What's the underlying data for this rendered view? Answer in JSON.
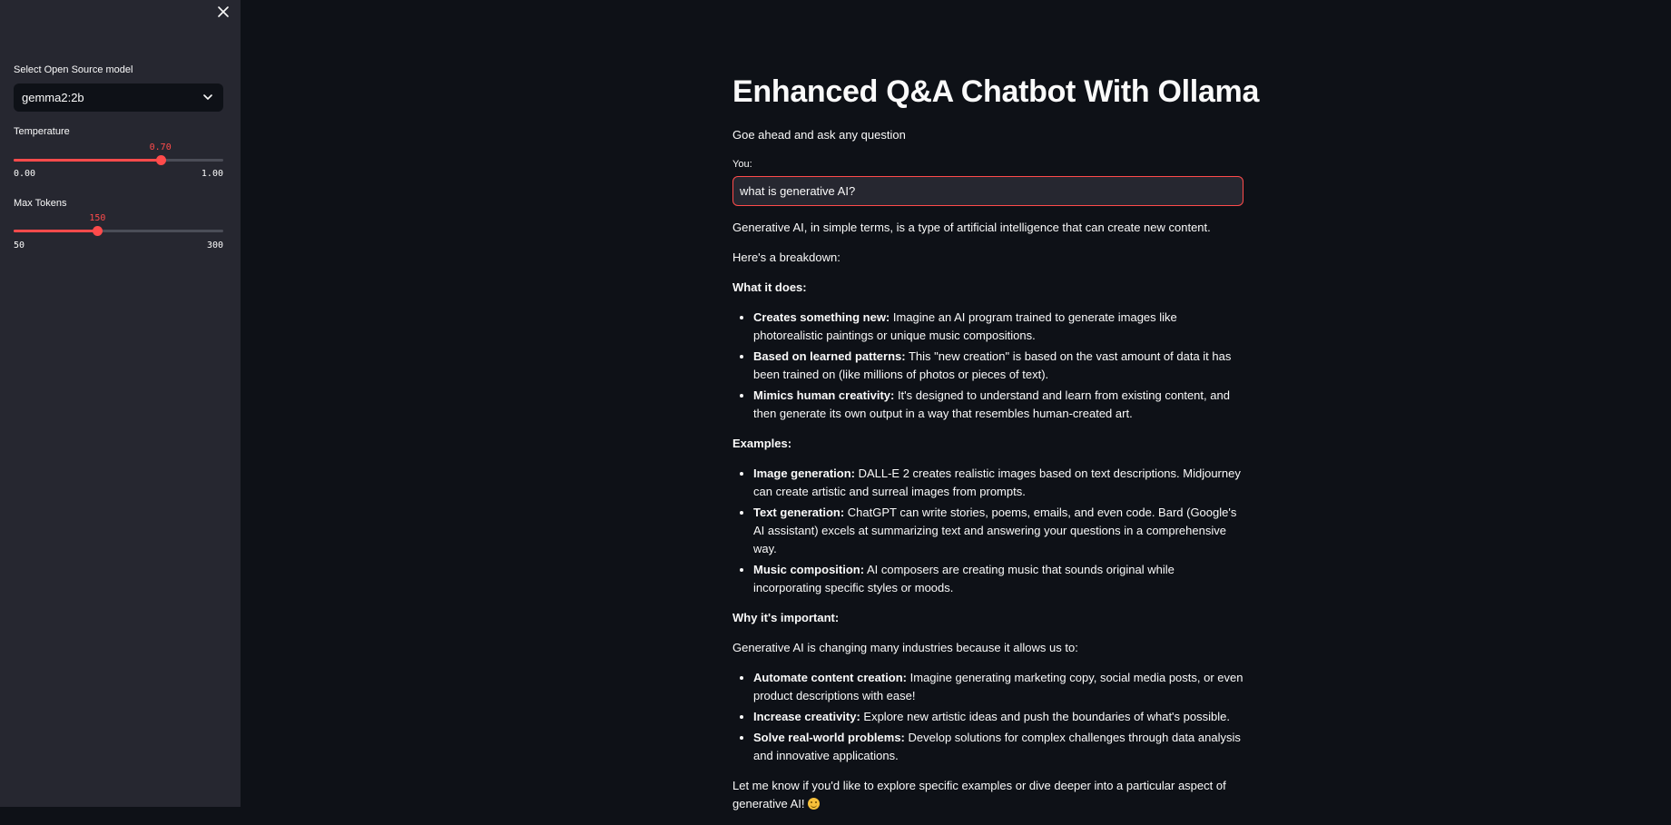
{
  "sidebar": {
    "model_label": "Select Open Source model",
    "model_value": "gemma2:2b",
    "temperature": {
      "label": "Temperature",
      "value": 0.7,
      "value_text": "0.70",
      "min": 0,
      "max": 1,
      "min_text": "0.00",
      "max_text": "1.00"
    },
    "max_tokens": {
      "label": "Max Tokens",
      "value": 150,
      "value_text": "150",
      "min": 50,
      "max": 300,
      "min_text": "50",
      "max_text": "300"
    }
  },
  "main": {
    "title": "Enhanced Q&A Chatbot With Ollama",
    "subtitle": "Goe ahead and ask any question",
    "input_label": "You:",
    "input_value": "what is generative AI?",
    "answer": {
      "intro": "Generative AI, in simple terms, is a type of artificial intelligence that can create new content.",
      "breakdown": "Here's a breakdown:",
      "section1_heading": "What it does:",
      "section1_items": [
        {
          "bold": "Creates something new:",
          "text": " Imagine an AI program trained to generate images like photorealistic paintings or unique music compositions."
        },
        {
          "bold": "Based on learned patterns:",
          "text": " This \"new creation\" is based on the vast amount of data it has been trained on (like millions of photos or pieces of text)."
        },
        {
          "bold": "Mimics human creativity:",
          "text": " It's designed to understand and learn from existing content, and then generate its own output in a way that resembles human-created art."
        }
      ],
      "section2_heading": "Examples:",
      "section2_items": [
        {
          "bold": "Image generation:",
          "text": " DALL-E 2 creates realistic images based on text descriptions. Midjourney can create artistic and surreal images from prompts."
        },
        {
          "bold": "Text generation:",
          "text": " ChatGPT can write stories, poems, emails, and even code. Bard (Google's AI assistant) excels at summarizing text and answering your questions in a comprehensive way."
        },
        {
          "bold": "Music composition:",
          "text": " AI composers are creating music that sounds original while incorporating specific styles or moods."
        }
      ],
      "section3_heading": "Why it's important:",
      "section3_intro": "Generative AI is changing many industries because it allows us to:",
      "section3_items": [
        {
          "bold": "Automate content creation:",
          "text": " Imagine generating marketing copy, social media posts, or even product descriptions with ease!"
        },
        {
          "bold": "Increase creativity:",
          "text": " Explore new artistic ideas and push the boundaries of what's possible."
        },
        {
          "bold": "Solve real-world problems:",
          "text": " Develop solutions for complex challenges through data analysis and innovative applications."
        }
      ],
      "closing": "Let me know if you'd like to explore specific examples or dive deeper into a particular aspect of generative AI! "
    }
  },
  "colors": {
    "accent": "#ff4b4b",
    "sidebar_bg": "#262730",
    "main_bg": "#0e1117"
  },
  "icons": {
    "close": "close-icon",
    "chevron": "chevron-down-icon",
    "emoji": "smiling-face-emoji-icon"
  }
}
